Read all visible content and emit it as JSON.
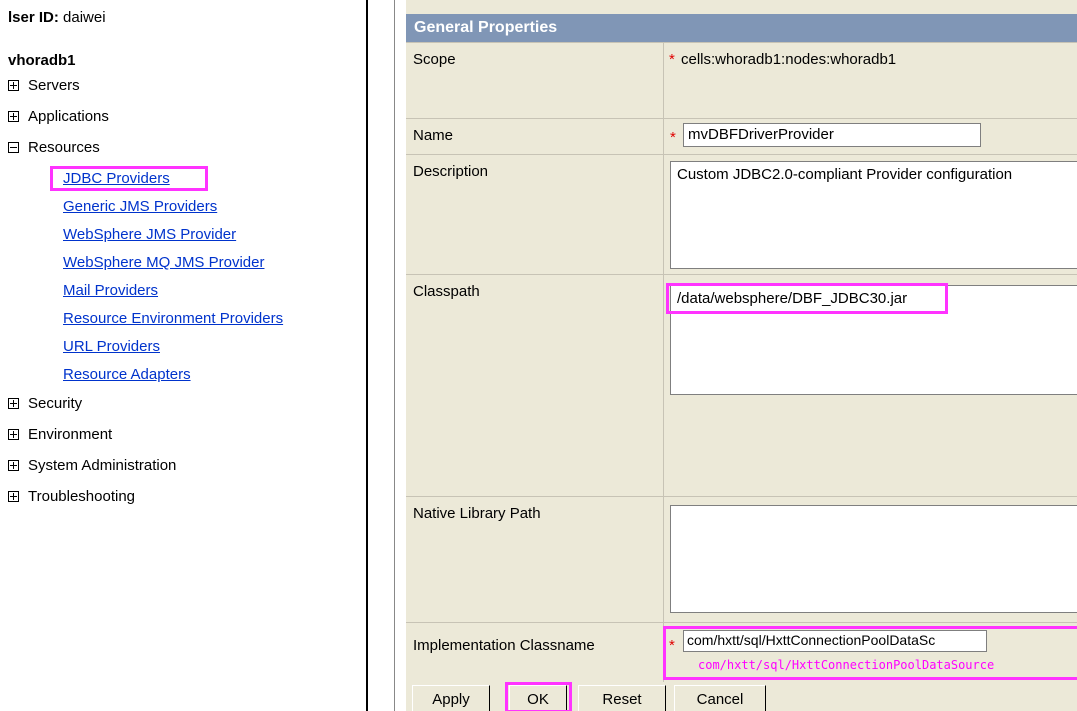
{
  "nav": {
    "user_id_label": "lser ID:",
    "user_id_value": "daiwei",
    "node_name": "vhoradb1",
    "tree": [
      {
        "label": "Servers",
        "state": "collapsed"
      },
      {
        "label": "Applications",
        "state": "collapsed"
      },
      {
        "label": "Resources",
        "state": "expanded"
      },
      {
        "label": "Security",
        "state": "collapsed"
      },
      {
        "label": "Environment",
        "state": "collapsed"
      },
      {
        "label": "System Administration",
        "state": "collapsed"
      },
      {
        "label": "Troubleshooting",
        "state": "collapsed"
      }
    ],
    "resources_links": [
      "JDBC Providers",
      "Generic JMS Providers",
      "WebSphere JMS Provider",
      "WebSphere MQ JMS Provider",
      "Mail Providers",
      "Resource Environment Providers",
      "URL Providers",
      "Resource Adapters"
    ]
  },
  "properties": {
    "section_title": "General Properties",
    "required_marker": "*",
    "scope": {
      "label": "Scope",
      "value": "cells:whoradb1:nodes:whoradb1"
    },
    "name": {
      "label": "Name",
      "value": "mvDBFDriverProvider"
    },
    "description": {
      "label": "Description",
      "value": "Custom JDBC2.0-compliant Provider configuration"
    },
    "classpath": {
      "label": "Classpath",
      "value": "/data/websphere/DBF_JDBC30.jar"
    },
    "native_library_path": {
      "label": "Native Library Path",
      "value": ""
    },
    "implementation_classname": {
      "label": "Implementation Classname",
      "value": "com/hxtt/sql/HxttConnectionPoolDataSc",
      "annotation": "com/hxtt/sql/HxttConnectionPoolDataSource"
    }
  },
  "buttons": {
    "apply": "Apply",
    "ok": "OK",
    "reset": "Reset",
    "cancel": "Cancel"
  },
  "colors": {
    "highlight": "#ff33ff",
    "section_header": "#8096b6",
    "panel_bg": "#ece9d8",
    "link": "#0033cc",
    "required": "#e00000"
  }
}
